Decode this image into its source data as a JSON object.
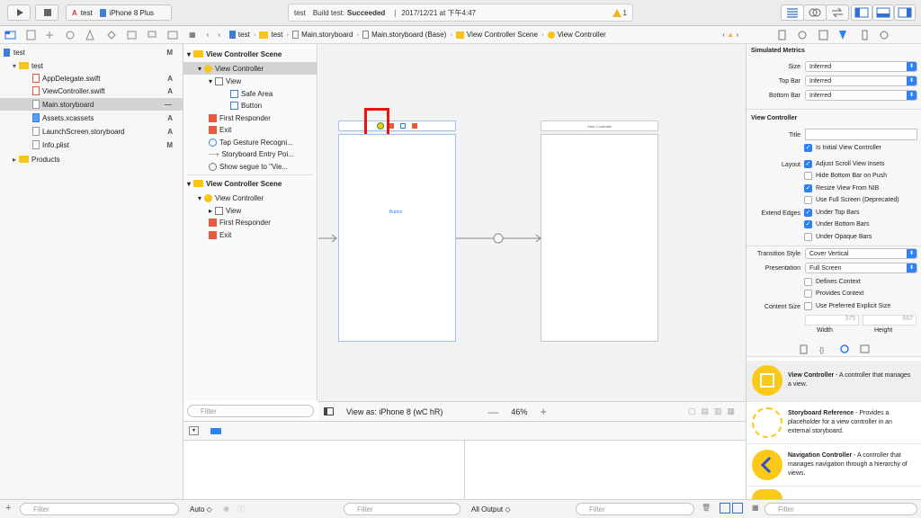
{
  "toolbar": {
    "scheme": "test",
    "device": "iPhone 8 Plus",
    "status_project": "test",
    "status_build": "Build test:",
    "status_result": "Succeeded",
    "status_time": "2017/12/21 at 下午4:47",
    "warnings": "1"
  },
  "navigator": {
    "items": [
      {
        "label": "test",
        "status": "M"
      },
      {
        "label": "test",
        "status": ""
      },
      {
        "label": "AppDelegate.swift",
        "status": "A"
      },
      {
        "label": "ViewController.swift",
        "status": "A"
      },
      {
        "label": "Main.storyboard",
        "status": "—"
      },
      {
        "label": "Assets.xcassets",
        "status": "A"
      },
      {
        "label": "LaunchScreen.storyboard",
        "status": "A"
      },
      {
        "label": "Info.plist",
        "status": "M"
      },
      {
        "label": "Products",
        "status": ""
      }
    ],
    "filter_placeholder": "Filter"
  },
  "jumpbar": [
    "test",
    "test",
    "Main.storyboard",
    "Main.storyboard (Base)",
    "View Controller Scene",
    "View Controller"
  ],
  "outline": {
    "items": [
      "View Controller Scene",
      "View Controller",
      "View",
      "Safe Area",
      "Button",
      "First Responder",
      "Exit",
      "Tap Gesture Recogni...",
      "Storyboard Entry Poi...",
      "Show segue to \"Vie...",
      "View Controller Scene",
      "View Controller",
      "View",
      "First Responder",
      "Exit"
    ],
    "filter_placeholder": "Filter"
  },
  "canvas": {
    "button_label": "Button",
    "vc2_title": "View Controller",
    "view_as": "View as: iPhone 8 (wC hR)",
    "zoom": "46%"
  },
  "debug": {
    "auto": "Auto ◇",
    "filter": "Filter",
    "all_output": "All Output ◇"
  },
  "inspector": {
    "sim_header": "Simulated Metrics",
    "size_label": "Size",
    "size": "Inferred",
    "topbar_label": "Top Bar",
    "topbar": "Inferred",
    "bottombar_label": "Bottom Bar",
    "bottombar": "Inferred",
    "vc_header": "View Controller",
    "title_label": "Title",
    "initial": "Is Initial View Controller",
    "layout_label": "Layout",
    "adjust": "Adjust Scroll View Insets",
    "hide_bottom": "Hide Bottom Bar on Push",
    "resize": "Resize View From NIB",
    "fullscreen": "Use Full Screen (Deprecated)",
    "extend_label": "Extend Edges",
    "under_top": "Under Top Bars",
    "under_bottom": "Under Bottom Bars",
    "under_opaque": "Under Opaque Bars",
    "transition_label": "Transition Style",
    "transition": "Cover Vertical",
    "presentation_label": "Presentation",
    "presentation": "Full Screen",
    "defines": "Defines Context",
    "provides": "Provides Context",
    "content_label": "Content Size",
    "preferred": "Use Preferred Explicit Size",
    "width_val": "375",
    "height_val": "667",
    "width_label": "Width",
    "height_label": "Height"
  },
  "library": [
    {
      "title": "View Controller",
      "desc": " - A controller that manages a view."
    },
    {
      "title": "Storyboard Reference",
      "desc": " - Provides a placeholder for a view controller in an external storyboard."
    },
    {
      "title": "Navigation Controller",
      "desc": " - A controller that manages navigation through a hierarchy of views."
    }
  ],
  "library_filter": "Filter"
}
